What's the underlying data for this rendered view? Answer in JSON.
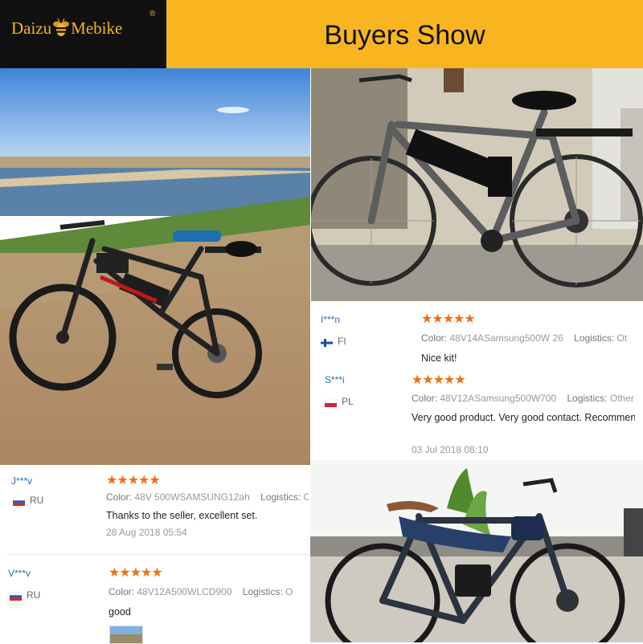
{
  "header": {
    "brand_left": "Daizu",
    "brand_right": "Mebike",
    "registered": "®",
    "title": "Buyers Show"
  },
  "colors": {
    "header_bg": "#f9b520",
    "logo_bg": "#111111",
    "brand_text": "#f4b51c",
    "star": "#f26f12",
    "name": "#2f6bb8"
  },
  "reviews": [
    {
      "user": "I***n",
      "country": "FI",
      "stars": "★★★★★",
      "color_label": "Color:",
      "color_value": "48V14ASamsung500W 26",
      "logistics_label": "Logistics:",
      "logistics_value": "Ot",
      "comment": "Nice kit!"
    },
    {
      "user": "S***i",
      "country": "PL",
      "stars": "★★★★★",
      "color_label": "Color:",
      "color_value": "48V12ASamsung500W700",
      "logistics_label": "Logistics:",
      "logistics_value": "Other",
      "comment": "Very good product. Very good contact. Recommend",
      "date": "03 Jul 2018 08:10"
    },
    {
      "user": "J***v",
      "country": "RU",
      "stars": "★★★★★",
      "color_label": "Color:",
      "color_value": "48V 500WSAMSUNG12ah",
      "logistics_label": "Logistics:",
      "logistics_value": "O",
      "comment": "Thanks to the seller, excellent set.",
      "date": "28 Aug 2018 05:54"
    },
    {
      "user": "V***v",
      "country": "RU",
      "stars": "★★★★★",
      "color_label": "Color:",
      "color_value": "48V12A500WLCD900",
      "logistics_label": "Logistics:",
      "logistics_value": "O",
      "comment": "good"
    }
  ]
}
